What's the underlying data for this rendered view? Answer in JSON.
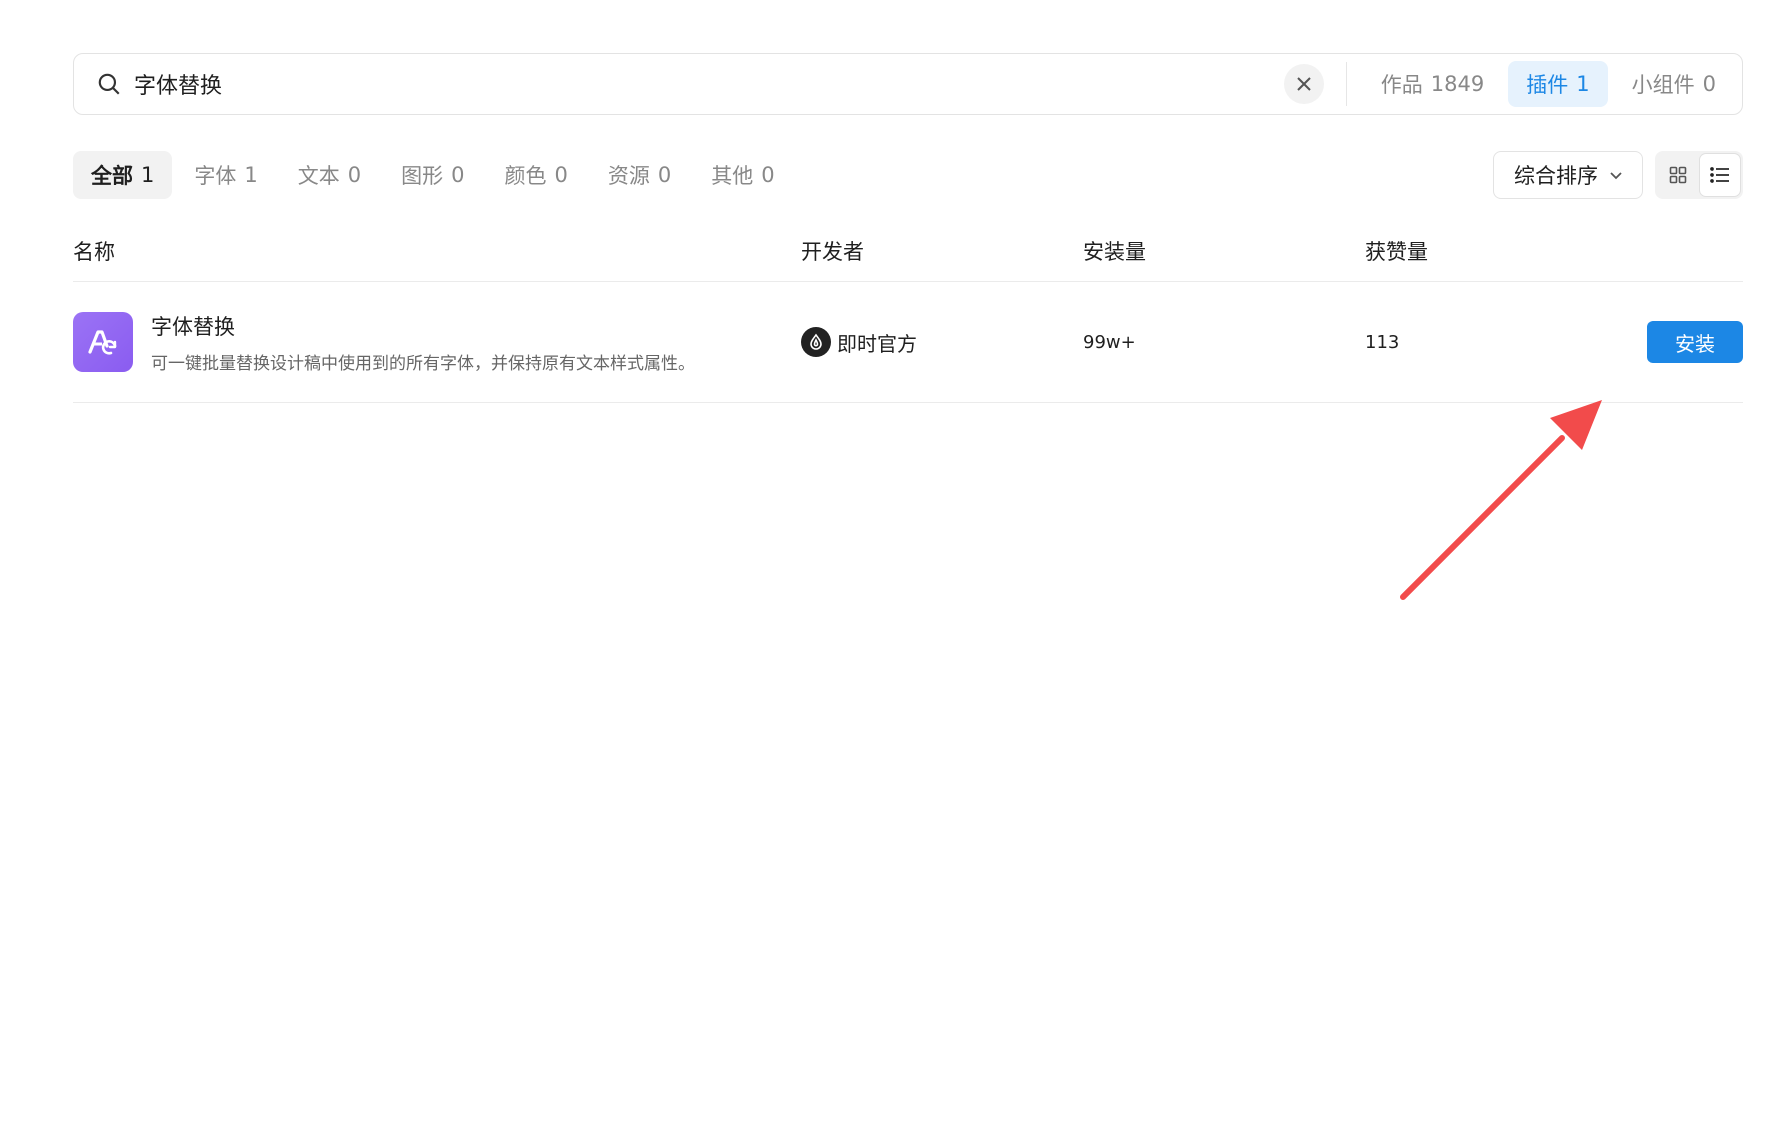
{
  "search": {
    "query": "字体替换"
  },
  "scope_tabs": [
    {
      "label": "作品",
      "count": "1849"
    },
    {
      "label": "插件",
      "count": "1"
    },
    {
      "label": "小组件",
      "count": "0"
    }
  ],
  "categories": [
    {
      "label": "全部",
      "count": "1"
    },
    {
      "label": "字体",
      "count": "1"
    },
    {
      "label": "文本",
      "count": "0"
    },
    {
      "label": "图形",
      "count": "0"
    },
    {
      "label": "颜色",
      "count": "0"
    },
    {
      "label": "资源",
      "count": "0"
    },
    {
      "label": "其他",
      "count": "0"
    }
  ],
  "sort": {
    "label": "综合排序"
  },
  "table": {
    "headers": {
      "name": "名称",
      "developer": "开发者",
      "installs": "安装量",
      "likes": "获赞量"
    },
    "rows": [
      {
        "title": "字体替换",
        "description": "可一键批量替换设计稿中使用到的所有字体，并保持原有文本样式属性。",
        "developer": "即时官方",
        "installs": "99w+",
        "likes": "113",
        "action": "安装"
      }
    ]
  },
  "colors": {
    "accent": "#1c87e5",
    "arrow": "#f24b4b",
    "icon_bg": "#9b73f5"
  }
}
